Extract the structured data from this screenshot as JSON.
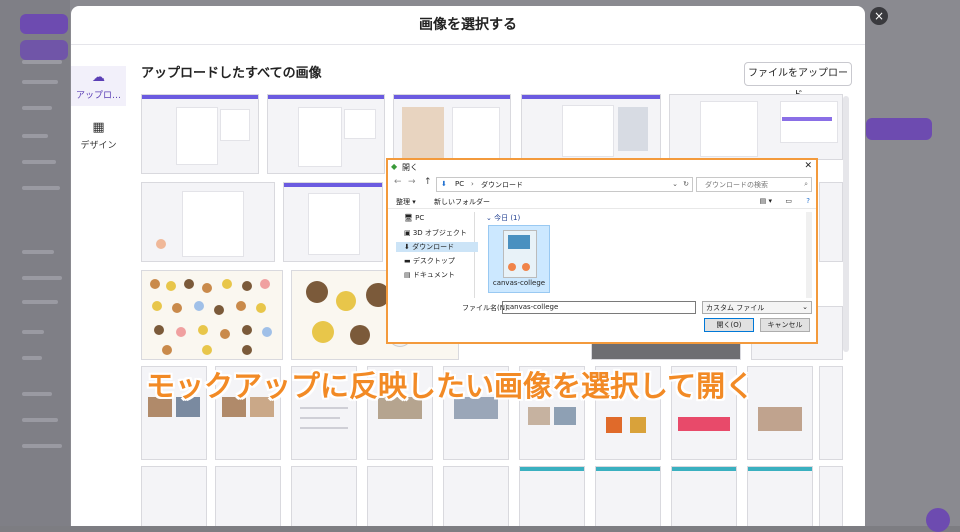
{
  "modal": {
    "title": "画像を選択する",
    "close_icon": "×"
  },
  "sidebar": {
    "items": [
      {
        "label": "アップロ…",
        "icon": "cloud-upload-icon"
      },
      {
        "label": "デザイン",
        "icon": "grid-icon"
      }
    ]
  },
  "main": {
    "section_title": "アップロードしたすべての画像",
    "upload_button": "ファイルをアップロード"
  },
  "file_dialog": {
    "title": "開く",
    "close": "✕",
    "breadcrumb": [
      "PC",
      "ダウンロード"
    ],
    "search_placeholder": "ダウンロードの検索",
    "toolbar": {
      "organize": "整理 ▾",
      "new_folder": "新しいフォルダー"
    },
    "tree": [
      {
        "label": "PC"
      },
      {
        "label": "3D オブジェクト"
      },
      {
        "label": "ダウンロード",
        "selected": true
      },
      {
        "label": "デスクトップ"
      },
      {
        "label": "ドキュメント"
      }
    ],
    "group_label": "今日 (1)",
    "files": [
      {
        "name": "canvas-college"
      }
    ],
    "filename_label": "ファイル名(N):",
    "filename_value": "canvas-college",
    "filetype_value": "カスタム ファイル",
    "open_button": "開く(O)",
    "cancel_button": "キャンセル"
  },
  "caption": "モックアップに反映したい画像を選択して開く",
  "colors": {
    "accent": "#6d4bb0",
    "caption_orange": "#f28a25",
    "dialog_border": "#f39a3c"
  }
}
